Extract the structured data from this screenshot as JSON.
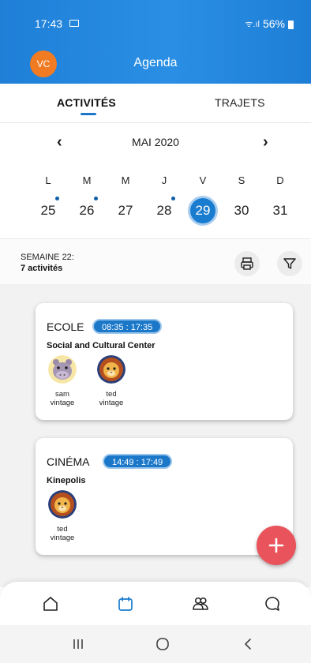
{
  "status_bar": {
    "time": "17:43",
    "battery": "56%",
    "image_icon": "image-icon",
    "signal_icon": "wifi-signal-icon",
    "battery_icon": "battery-icon"
  },
  "app_bar": {
    "avatar_initials": "VC",
    "avatar_color": "#f07b22",
    "title": "Agenda"
  },
  "tabs": [
    {
      "label": "ACTIVITÉS",
      "active": true
    },
    {
      "label": "TRAJETS",
      "active": false
    }
  ],
  "calendar": {
    "month_label": "MAI 2020",
    "prev_icon": "chevron-left-icon",
    "next_icon": "chevron-right-icon",
    "weekdays": [
      "L",
      "M",
      "M",
      "J",
      "V",
      "S",
      "D"
    ],
    "days": [
      {
        "num": "25",
        "has_event": true,
        "selected": false
      },
      {
        "num": "26",
        "has_event": true,
        "selected": false
      },
      {
        "num": "27",
        "has_event": false,
        "selected": false
      },
      {
        "num": "28",
        "has_event": true,
        "selected": false
      },
      {
        "num": "29",
        "has_event": false,
        "selected": true
      },
      {
        "num": "30",
        "has_event": false,
        "selected": false
      },
      {
        "num": "31",
        "has_event": false,
        "selected": false
      }
    ]
  },
  "week": {
    "label": "SEMAINE 22:",
    "count": "7 activités",
    "print_icon": "print-icon",
    "filter_icon": "filter-icon"
  },
  "activities": [
    {
      "title": "ECOLE",
      "time": "08:35 : 17:35",
      "place": "Social and Cultural Center",
      "participants": [
        {
          "first": "sam",
          "last": "vintage",
          "avatar": "hippo-avatar-icon"
        },
        {
          "first": "ted",
          "last": "vintage",
          "avatar": "lion-avatar-icon"
        }
      ]
    },
    {
      "title": "CINÉMA",
      "time": "14:49 : 17:49",
      "place": "Kinepolis",
      "participants": [
        {
          "first": "ted",
          "last": "vintage",
          "avatar": "lion-avatar-icon"
        }
      ]
    }
  ],
  "fab": {
    "icon": "plus-icon",
    "color": "#e9545c"
  },
  "bottom_nav": [
    {
      "icon": "home-icon",
      "active": false
    },
    {
      "icon": "calendar-icon",
      "active": true
    },
    {
      "icon": "group-icon",
      "active": false
    },
    {
      "icon": "chat-icon",
      "active": false
    }
  ],
  "system_nav": [
    "recents-icon",
    "home-circle-icon",
    "back-icon"
  ],
  "colors": {
    "primary": "#1a7ccf",
    "header_gradient_start": "#1f7fd8",
    "accent_red": "#e9545c",
    "list_bg": "#f2f2f2"
  }
}
